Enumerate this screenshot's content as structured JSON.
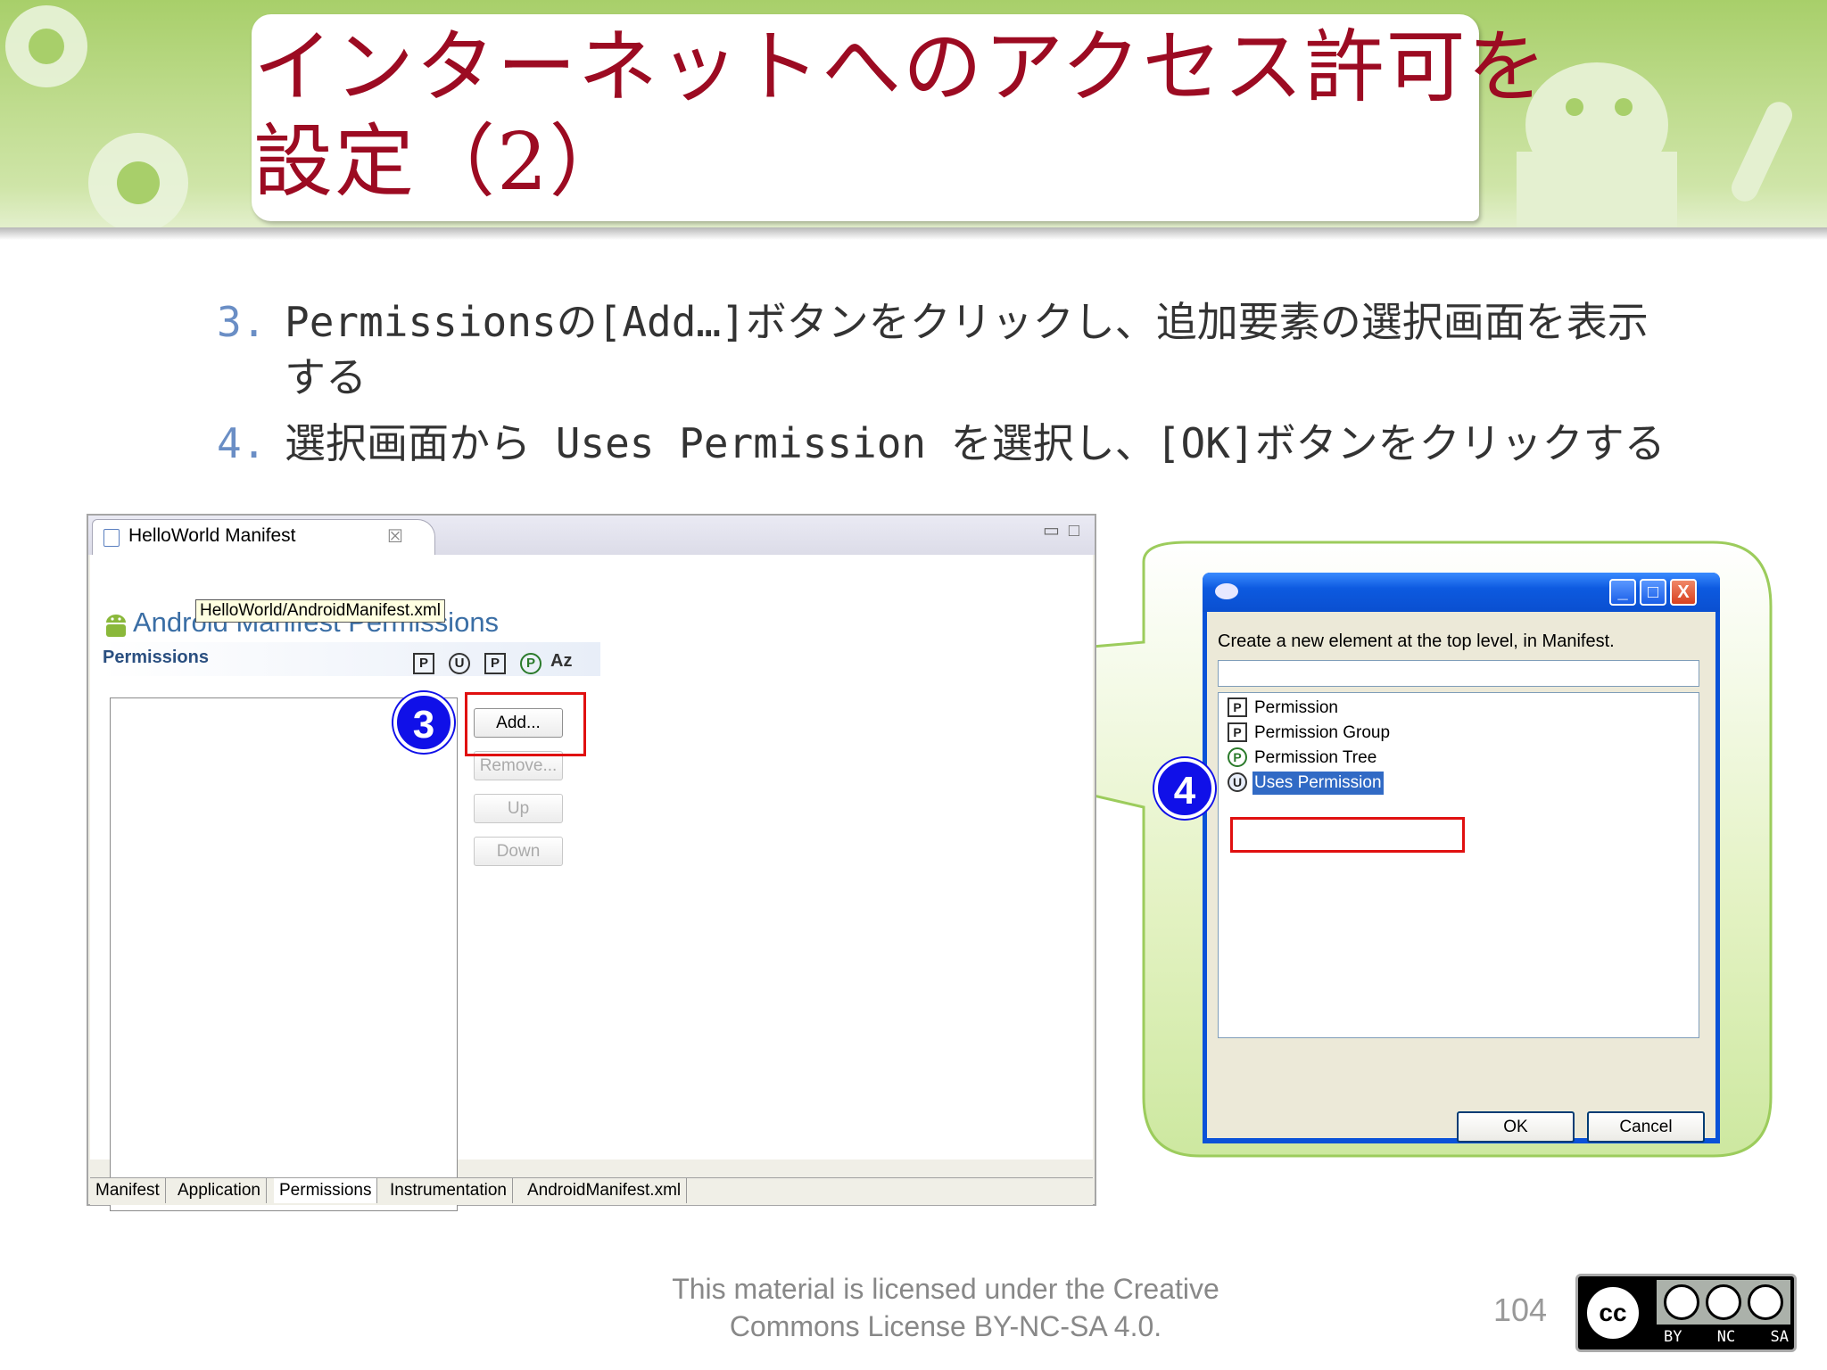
{
  "slide": {
    "title_line1": "インターネットへのアクセス許可を",
    "title_line2": "設定（2）",
    "bullets": [
      {
        "num": "3.",
        "line1": "Permissionsの[Add…]ボタンをクリックし、追加要素の選択画面を表示",
        "line2": "する"
      },
      {
        "num": "4.",
        "line1": "選択画面から Uses Permission を選択し、[OK]ボタンをクリックする"
      }
    ],
    "license_line1": "This material is licensed under the Creative",
    "license_line2": "Commons License BY-NC-SA 4.0.",
    "page_number": "104",
    "cc_badge": {
      "left": "cc",
      "labels": [
        "BY",
        "NC",
        "SA"
      ]
    }
  },
  "eclipse": {
    "tab_title": "HelloWorld Manifest",
    "tab_close": "☒",
    "heading": "Android Manifest Permissions",
    "tooltip": "HelloWorld/AndroidManifest.xml",
    "section_title": "Permissions",
    "toolbar_icons": [
      "P",
      "U",
      "P",
      "P",
      "Az"
    ],
    "buttons": {
      "add": "Add...",
      "remove": "Remove...",
      "up": "Up",
      "down": "Down"
    },
    "bottom_tabs": [
      "Manifest",
      "Application",
      "Permissions",
      "Instrumentation",
      "AndroidManifest.xml"
    ],
    "active_tab": "Permissions",
    "step_marker": "3"
  },
  "dialog": {
    "label": "Create a new element at the top level, in Manifest.",
    "items": [
      {
        "icon": "P",
        "label": "Permission"
      },
      {
        "icon": "P",
        "label": "Permission Group"
      },
      {
        "icon": "P",
        "label": "Permission Tree"
      },
      {
        "icon": "U",
        "label": "Uses Permission"
      }
    ],
    "selected": "Uses Permission",
    "ok": "OK",
    "cancel": "Cancel",
    "min": "_",
    "max": "□",
    "close": "X",
    "step_marker": "4"
  },
  "colors": {
    "title_red": "#9c0b22",
    "header_green": "#bfdc8e",
    "highlight_red": "#e01010",
    "step_blue": "#1010e8",
    "xp_blue": "#0a52d8"
  }
}
